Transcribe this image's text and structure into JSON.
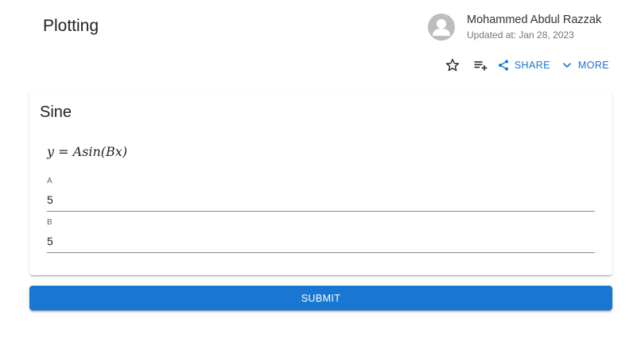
{
  "header": {
    "title": "Plotting",
    "author_name": "Mohammed Abdul Razzak",
    "updated_text": "Updated at: Jan 28, 2023"
  },
  "actions": {
    "star_icon": "star-outline-icon",
    "playlist_icon": "playlist-add-icon",
    "share_label": "SHARE",
    "share_icon": "share-icon",
    "more_label": "MORE",
    "more_icon": "chevron-down-icon"
  },
  "card": {
    "title": "Sine",
    "formula": "y = Asin(Bx)",
    "fields": [
      {
        "label": "A",
        "value": "5"
      },
      {
        "label": "B",
        "value": "5"
      }
    ]
  },
  "submit": {
    "label": "SUBMIT"
  },
  "colors": {
    "accent": "#1976d2",
    "avatar_bg": "#bdbdbd"
  }
}
